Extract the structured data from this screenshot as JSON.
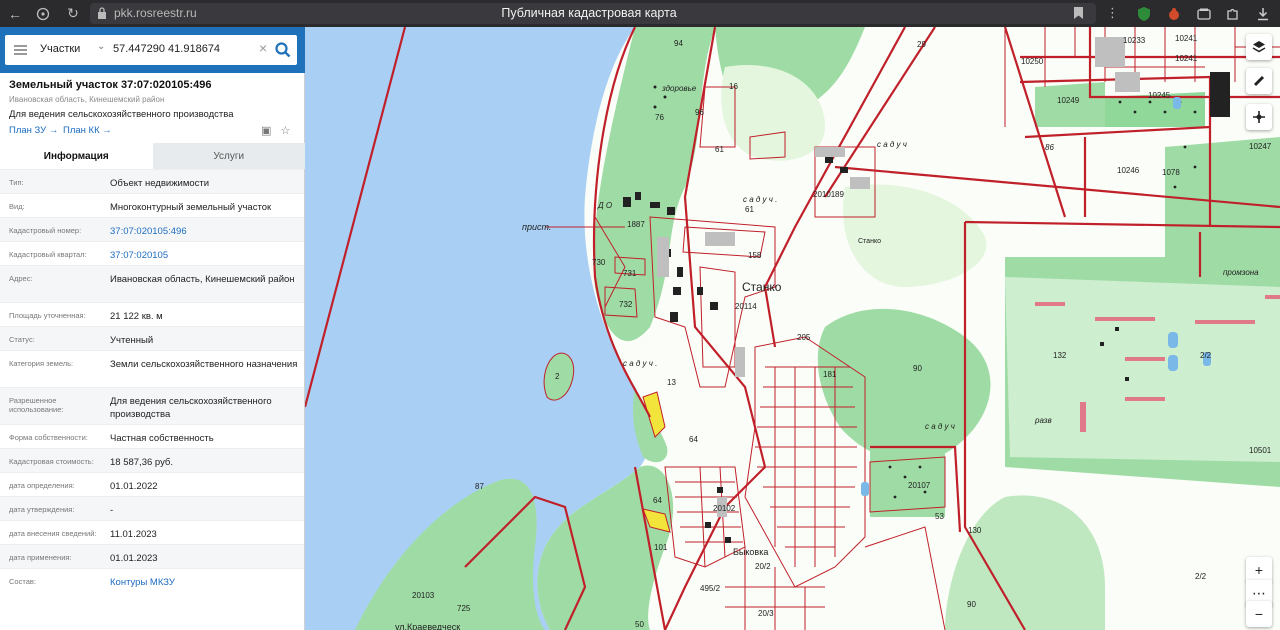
{
  "browser": {
    "url": "pkk.rosreestr.ru",
    "page_title": "Публичная кадастровая карта",
    "icons": [
      "back-icon",
      "shield-icon",
      "reload-icon",
      "lock-icon",
      "bookmark-icon",
      "menu-dots-icon",
      "extension-icons",
      "download-icon"
    ]
  },
  "search": {
    "category": "Участки",
    "query": "57.447290 41.918674",
    "icons": [
      "menu-icon",
      "chevron-down-icon",
      "clear-icon",
      "search-icon",
      "collapse-icon"
    ]
  },
  "parcel": {
    "title": "Земельный участок 37:07:020105:496",
    "address": "Ивановская область, Кинешемский район",
    "use": "Для ведения сельскохозяйственного производства",
    "link_zu": "План ЗУ →",
    "link_kk": "План КК →"
  },
  "tabs": {
    "info": "Информация",
    "services": "Услуги"
  },
  "fields": [
    {
      "label": "Тип:",
      "value": "Объект недвижимости",
      "link": false
    },
    {
      "label": "Вид:",
      "value": "Многоконтурный земельный участок",
      "link": false
    },
    {
      "label": "Кадастровый номер:",
      "value": "37:07:020105:496",
      "link": true
    },
    {
      "label": "Кадастровый квартал:",
      "value": "37:07:020105",
      "link": true
    },
    {
      "label": "Адрес:",
      "value": "Ивановская область, Кинешемский район",
      "link": false
    },
    {
      "label": "Площадь уточненная:",
      "value": "21 122 кв. м",
      "link": false
    },
    {
      "label": "Статус:",
      "value": "Учтенный",
      "link": false
    },
    {
      "label": "Категория земель:",
      "value": "Земли сельскохозяйственного назначения",
      "link": false
    },
    {
      "label": "Разрешенное использование:",
      "value": "Для ведения сельскохозяйственного производства",
      "link": false
    },
    {
      "label": "Форма собственности:",
      "value": "Частная собственность",
      "link": false
    },
    {
      "label": "Кадастровая стоимость:",
      "value": "18 587,36 руб.",
      "link": false
    },
    {
      "label": "дата определения:",
      "value": "01.01.2022",
      "link": false
    },
    {
      "label": "дата утверждения:",
      "value": "-",
      "link": false
    },
    {
      "label": "дата внесения сведений:",
      "value": "11.01.2023",
      "link": false
    },
    {
      "label": "дата применения:",
      "value": "01.01.2023",
      "link": false
    },
    {
      "label": "Состав:",
      "value": "Контуры МКЗУ",
      "link": true
    }
  ],
  "map": {
    "labels": {
      "l94": "94",
      "l96": "96",
      "l76": "76",
      "l61a": "61",
      "l61b": "61",
      "l16": "16",
      "zdorov": "здоровье",
      "lD": "Д О",
      "l1887": "1887",
      "l730": "730",
      "l731": "731",
      "l732": "732",
      "prist": "прист.",
      "sad1": "с а д у ч .",
      "sad2": "с а д у ч",
      "sad3": "с а д у ч .",
      "sad4": "с а д у ч",
      "l158": "158",
      "stanko": "Станко",
      "l20114": "20114",
      "l205": "205",
      "l181": "181",
      "l13": "13",
      "l2": "2",
      "l64a": "64",
      "l64b": "64",
      "l87": "87",
      "l20102": "20102",
      "bykovka": "Быковка",
      "l20_2": "20/2",
      "l20_3": "20/3",
      "l195_2": "495/2",
      "l20103": "20103",
      "l725": "725",
      "l101": "101",
      "l89": "89",
      "l50": "50",
      "l90a": "90",
      "l90b": "90",
      "l86": "86",
      "l29": "29",
      "l10250": "10250",
      "l10249": "10249",
      "l10245": "10245",
      "l10247": "10247",
      "l10246": "10246",
      "l1078": "1078",
      "l20101": "20101",
      "stanko2": "Станко",
      "promzona": "промзона",
      "l132": "132",
      "l2_2a": "2/2",
      "razv": "разв",
      "l10501": "10501",
      "l20107": "20107",
      "l53": "53",
      "l130": "130",
      "l2_2b": "2/2",
      "lkraeved": "ул.Краеведческ",
      "l10233": "10233",
      "l10241": "10241",
      "l1024x": "10241"
    },
    "controls": [
      "layers-icon",
      "ruler-icon",
      "locate-icon",
      "zoom-in-icon",
      "more-icon",
      "zoom-out-icon"
    ],
    "colors": {
      "water": "#a9d0f4",
      "forest": "#9fdca5",
      "field": "#e8f6e8",
      "boundary": "#c0202a",
      "bg": "#fbfdf8"
    }
  }
}
